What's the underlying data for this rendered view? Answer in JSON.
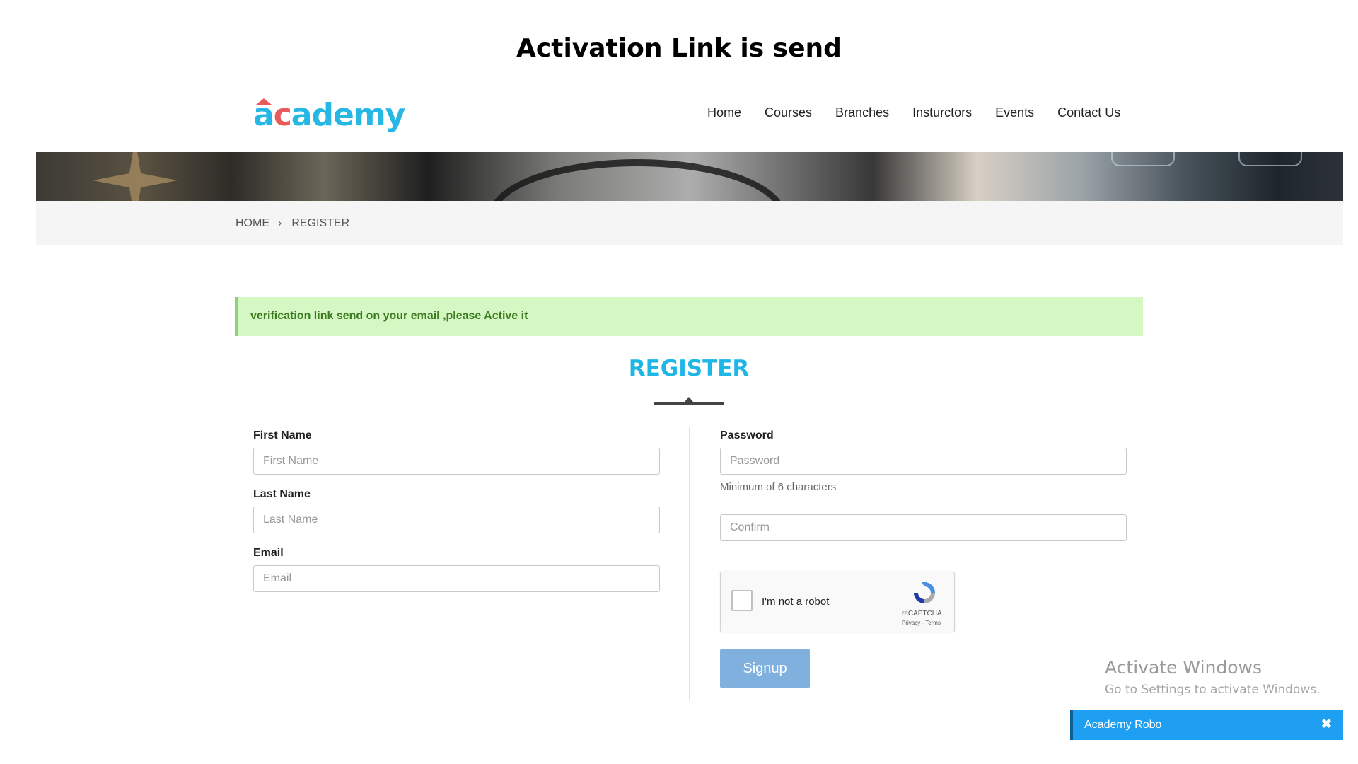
{
  "page_title": "Activation Link is send",
  "logo": {
    "text_before": "a",
    "accent": "c",
    "text_after": "ademy"
  },
  "nav": {
    "items": [
      "Home",
      "Courses",
      "Branches",
      "Insturctors",
      "Events",
      "Contact Us"
    ]
  },
  "breadcrumb": {
    "home": "HOME",
    "separator": "›",
    "current": "REGISTER"
  },
  "alert": {
    "message": "verification link send on your email ,please Active it"
  },
  "register": {
    "title": "REGISTER",
    "first_name": {
      "label": "First Name",
      "placeholder": "First Name"
    },
    "last_name": {
      "label": "Last Name",
      "placeholder": "Last Name"
    },
    "email": {
      "label": "Email",
      "placeholder": "Email"
    },
    "password": {
      "label": "Password",
      "placeholder": "Password",
      "help": "Minimum of 6 characters"
    },
    "confirm": {
      "placeholder": "Confirm"
    },
    "captcha": {
      "label": "I'm not a robot",
      "brand": "reCAPTCHA",
      "terms": "Privacy - Terms"
    },
    "signup_label": "Signup"
  },
  "windows_watermark": {
    "title": "Activate Windows",
    "subtitle": "Go to Settings to activate Windows."
  },
  "chat": {
    "name": "Academy Robo",
    "close_symbol": "✖"
  },
  "colors": {
    "accent": "#1db7e6",
    "alert_bg": "#d4f7c4",
    "alert_text": "#3c7b1f",
    "button": "#7fb0de",
    "chat": "#1e9ff2"
  }
}
